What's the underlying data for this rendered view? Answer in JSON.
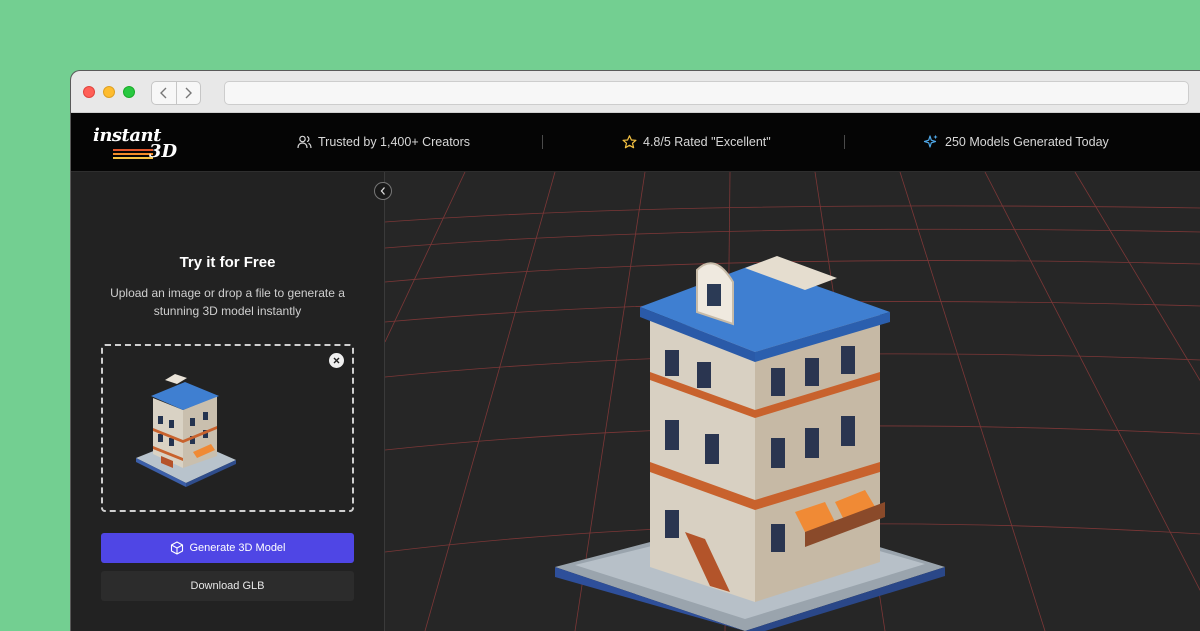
{
  "header": {
    "logo": {
      "line1": "instant",
      "line2": "3D"
    },
    "stats": [
      {
        "icon": "users-icon",
        "text": "Trusted by 1,400+ Creators"
      },
      {
        "icon": "star-icon",
        "text": "4.8/5 Rated \"Excellent\""
      },
      {
        "icon": "sparkles-icon",
        "text": "250 Models Generated Today"
      }
    ]
  },
  "sidebar": {
    "title": "Try it for Free",
    "subtitle": "Upload an image or drop a file to generate a stunning 3D model instantly",
    "generate_button": "Generate 3D Model",
    "download_button": "Download GLB"
  },
  "colors": {
    "background": "#73cf91",
    "accent": "#4f46e5",
    "header": "#050505",
    "panel": "#222222",
    "viewport": "#262626",
    "grid_line": "#c0504d"
  }
}
